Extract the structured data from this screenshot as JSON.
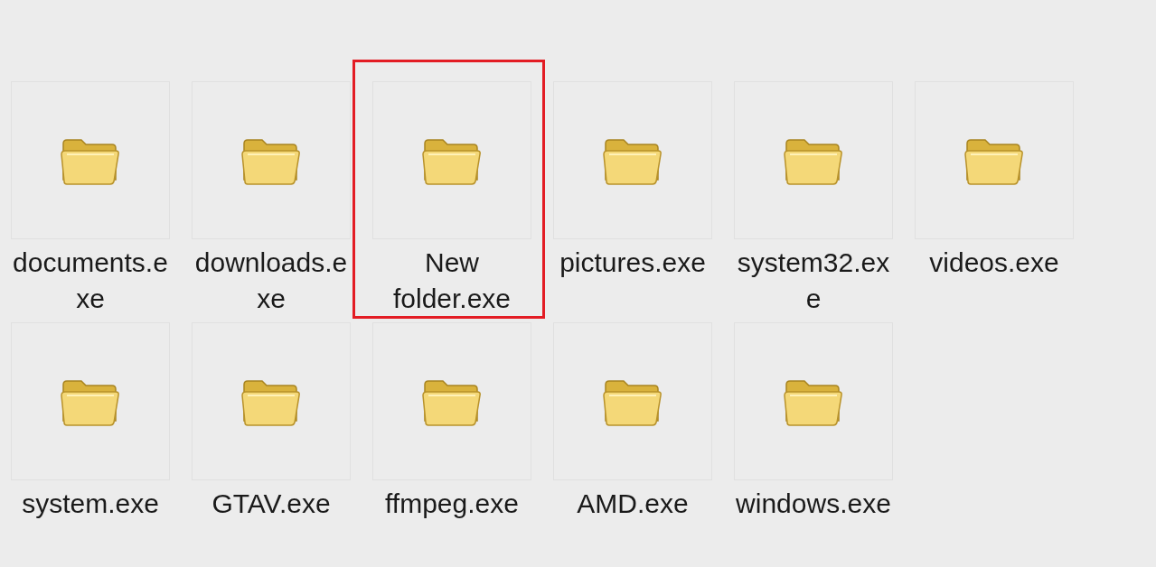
{
  "items": [
    {
      "name": "documents.exe",
      "highlighted": false
    },
    {
      "name": "downloads.exe",
      "highlighted": false
    },
    {
      "name": "New folder.exe",
      "highlighted": true
    },
    {
      "name": "pictures.exe",
      "highlighted": false
    },
    {
      "name": "system32.exe",
      "highlighted": false
    },
    {
      "name": "videos.exe",
      "highlighted": false
    },
    {
      "name": "system.exe",
      "highlighted": false
    },
    {
      "name": "GTAV.exe",
      "highlighted": false
    },
    {
      "name": "ffmpeg.exe",
      "highlighted": false
    },
    {
      "name": "AMD.exe",
      "highlighted": false
    },
    {
      "name": "windows.exe",
      "highlighted": false
    }
  ]
}
